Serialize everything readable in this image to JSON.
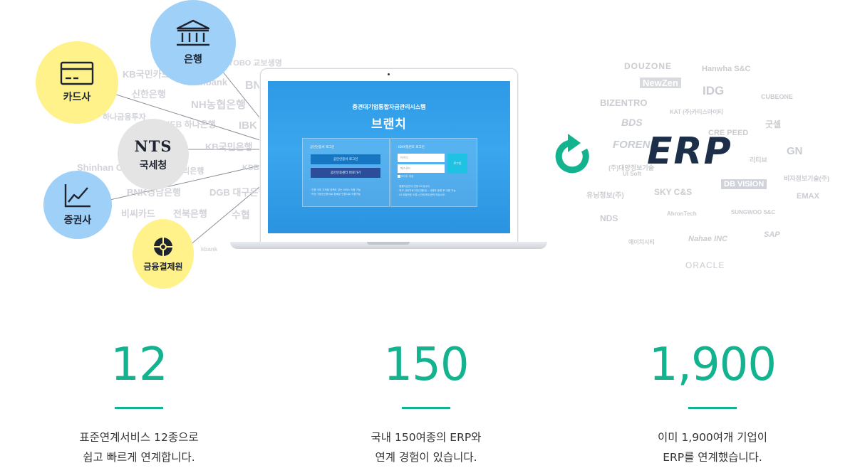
{
  "categories": {
    "card": "카드사",
    "bank": "은행",
    "nts_logo": "NTS",
    "nts": "국세청",
    "securities": "증권사",
    "fintech": "금융결제원"
  },
  "left_logos": [
    "KB국민카드",
    "KYOBO 교보생명",
    "신한은행",
    "shinbank",
    "BNK",
    "NH농협은행",
    "하나금융투자",
    "KEB 하나은행",
    "IBK",
    "KB국민은행",
    "Shinhan Card",
    "우리은행",
    "BNK경남은행",
    "DGB 대구은행",
    "비씨카드",
    "전북은행",
    "수협",
    "KDB",
    "kbank"
  ],
  "laptop": {
    "title": "중견대기업통합자금관리시스템",
    "brand": "브랜치",
    "cert_panel": {
      "heading": "공인인증서 로그인",
      "login_button": "공인인증서 로그인",
      "register_button": "공인인증센터 바로가기",
      "notes": [
        "· 인증 이미 가져올 정책도 있는 서비스 이용 가능",
        "· 보안 기업인인증서로 등록된 인증서로 이용가능"
      ]
    },
    "id_panel": {
      "heading": "ID/비밀번호 로그인",
      "id_placeholder": "아이디",
      "pw_placeholder": "패스워드",
      "remember": "아이디 저장",
      "login_button": "로그인",
      "notes": [
        "· 통합자금관리 전용 ID 입니다.",
        "· 최초 관리자로그인(인증서) - 사용자 등록 후 이용 가능",
        "· ID 비밀번호 오류시 관리자에 문의 하십시오."
      ]
    }
  },
  "erp": {
    "label": "ERP",
    "refresh_icon": "refresh-arrow-icon",
    "accent": "#14b38f"
  },
  "right_logos": [
    "DOUZONE",
    "Hanwha S&C",
    "NewZen",
    "IDG",
    "BIZENTRO",
    "KAT (주)카티스마이티",
    "CUBEONE",
    "BDS",
    "CRE PEED",
    "FORENE",
    "굿셀",
    "(주)대양정보기술",
    "UI Soft",
    "리티브",
    "GN",
    "비자정보기술(주)",
    "유닝정보(주)",
    "SKY C&S",
    "DB VISION",
    "EMAX",
    "NDS",
    "AhronTech",
    "SUNGWOO S&C",
    "Nahae INC",
    "SAP",
    "에이치시티",
    "ORACLE"
  ],
  "stats": [
    {
      "number": "12",
      "line1": "표준연계서비스 12종으로",
      "line2": "쉽고 빠르게 연계합니다."
    },
    {
      "number": "150",
      "line1": "국내 150여종의 ERP와",
      "line2": "연계 경험이 있습니다."
    },
    {
      "number": "1,900",
      "line1": "이미 1,900여개 기업이",
      "line2": "ERP를 연계했습니다."
    }
  ],
  "colors": {
    "accent": "#14b38f",
    "yellow": "#fff28a",
    "blue": "#9fd0f7",
    "gray": "#e4e4e4",
    "erp_navy": "#1c2e48"
  }
}
